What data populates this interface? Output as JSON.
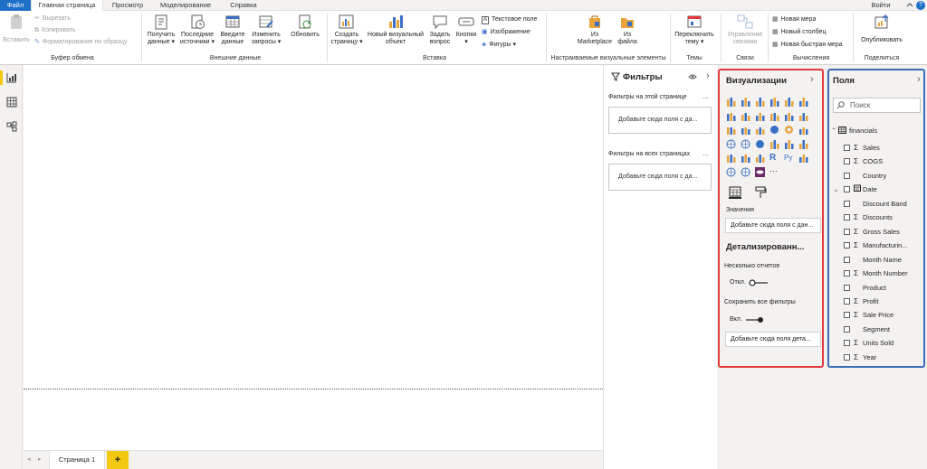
{
  "menu": {
    "tabs": [
      {
        "label": "Файл"
      },
      {
        "label": "Главная страница"
      },
      {
        "label": "Просмотр"
      },
      {
        "label": "Моделирование"
      },
      {
        "label": "Справка"
      }
    ],
    "signin": "Войти"
  },
  "ribbon": {
    "clipboard": {
      "paste": "Вставить",
      "cut": "Вырезать",
      "copy": "Копировать",
      "format_painter": "Форматирование по образцу",
      "group": "Буфер обмена"
    },
    "external": {
      "get_data": [
        "Получить",
        "данные ▾"
      ],
      "recent_sources": [
        "Последние",
        "источники ▾"
      ],
      "enter_data": [
        "Введите",
        "данные"
      ],
      "edit_queries": [
        "Изменить",
        "запросы ▾"
      ],
      "refresh": "Обновить",
      "group": "Внешние данные"
    },
    "insert": {
      "new_page": [
        "Создать",
        "страницу ▾"
      ],
      "new_visual": [
        "Новый визуальный",
        "объект"
      ],
      "ask_question": [
        "Задать",
        "вопрос"
      ],
      "buttons": [
        "Кнопки",
        "▾"
      ],
      "textbox": "Текстовое поле",
      "image": "Изображение",
      "shapes": "Фигуры ▾",
      "group": "Вставка"
    },
    "custom_visuals": {
      "marketplace": [
        "Из",
        "Marketplace"
      ],
      "from_file": [
        "Из",
        "файла"
      ],
      "group": "Настраиваемые визуальные элементы"
    },
    "themes": {
      "switch_theme": [
        "Переключить",
        "тему ▾"
      ],
      "group": "Темы"
    },
    "relationships": {
      "manage": [
        "Управление",
        "связями"
      ],
      "group": "Связи"
    },
    "calculations": {
      "new_measure": "Новая мера",
      "new_column": "Новый столбец",
      "new_quick_measure": "Новая быстрая мера",
      "group": "Вычисления"
    },
    "share": {
      "publish": "Опубликовать",
      "group": "Поделиться"
    }
  },
  "filters": {
    "title": "Фильтры",
    "on_page_label": "Фильтры на этой странице",
    "on_page_drop": "Добавьте сюда поля с да...",
    "all_pages_label": "Фильтры на всех страницах",
    "all_pages_drop": "Добавьте сюда поля с да...",
    "more": "...",
    "collapse": "›"
  },
  "visualizations": {
    "title": "Визуализации",
    "collapse": "›",
    "values_label": "Значения",
    "values_drop": "Добавьте сюда поля с дан...",
    "drillthrough_title": "Детализированн...",
    "cross_report_label": "Несколько отчетов",
    "cross_report_state": "Откл.",
    "keep_filters_label": "Сохранить все фильтры",
    "keep_filters_state": "Вкл.",
    "drill_drop": "Добавьте сюда поля дета...",
    "r_icon_letter": "R",
    "py_icon_letter": "Py",
    "more_icon": "···"
  },
  "fields": {
    "title": "Поля",
    "collapse": "›",
    "search_placeholder": "Поиск",
    "table_name": "financials",
    "items": [
      {
        "name": "Sales",
        "sigma": "Σ"
      },
      {
        "name": "COGS",
        "sigma": "Σ"
      },
      {
        "name": "Country",
        "sigma": ""
      },
      {
        "name": "Date",
        "sigma": ""
      },
      {
        "name": "Discount Band",
        "sigma": ""
      },
      {
        "name": "Discounts",
        "sigma": "Σ"
      },
      {
        "name": "Gross Sales",
        "sigma": "Σ"
      },
      {
        "name": "Manufacturin...",
        "sigma": "Σ"
      },
      {
        "name": "Month Name",
        "sigma": ""
      },
      {
        "name": "Month Number",
        "sigma": "Σ"
      },
      {
        "name": "Product",
        "sigma": ""
      },
      {
        "name": "Profit",
        "sigma": "Σ"
      },
      {
        "name": "Sale Price",
        "sigma": "Σ"
      },
      {
        "name": "Segment",
        "sigma": ""
      },
      {
        "name": "Units Sold",
        "sigma": "Σ"
      },
      {
        "name": "Year",
        "sigma": "Σ"
      }
    ]
  },
  "pages": {
    "tabs": [
      {
        "label": "Страница 1"
      }
    ],
    "add": "+",
    "prev": "◂",
    "next": "▸"
  },
  "colors": {
    "file_tab": "#1e6fc8",
    "viz_border": "#e0393e",
    "fields_border": "#3e6db5",
    "add_page": "#f2c811"
  }
}
